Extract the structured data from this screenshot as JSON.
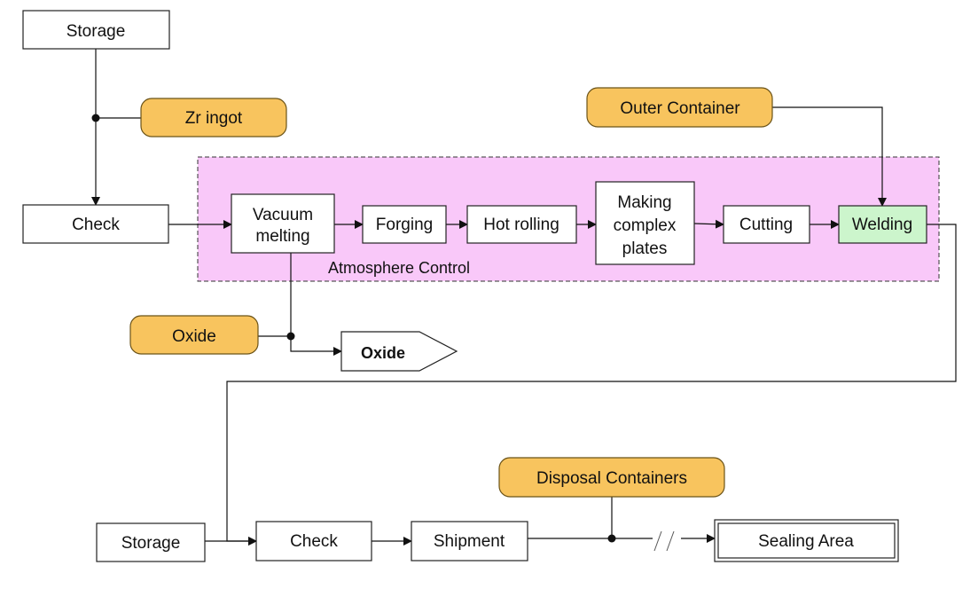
{
  "colors": {
    "supply": "#f8c45e",
    "zone": "#f9c8f9",
    "highlight": "#ccf5cc"
  },
  "nodes": {
    "storage_top": "Storage",
    "zr_ingot": "Zr ingot",
    "check_top": "Check",
    "vacuum_melting": [
      "Vacuum",
      "melting"
    ],
    "forging": "Forging",
    "hot_rolling": "Hot rolling",
    "making_complex_plates": [
      "Making",
      "complex",
      "plates"
    ],
    "cutting": "Cutting",
    "welding": "Welding",
    "outer_container": "Outer Container",
    "atmosphere_control": "Atmosphere Control",
    "oxide_input": "Oxide",
    "oxide_output": "Oxide",
    "storage_bottom": "Storage",
    "check_bottom": "Check",
    "shipment": "Shipment",
    "disposal_containers": "Disposal Containers",
    "sealing_area": "Sealing Area"
  }
}
